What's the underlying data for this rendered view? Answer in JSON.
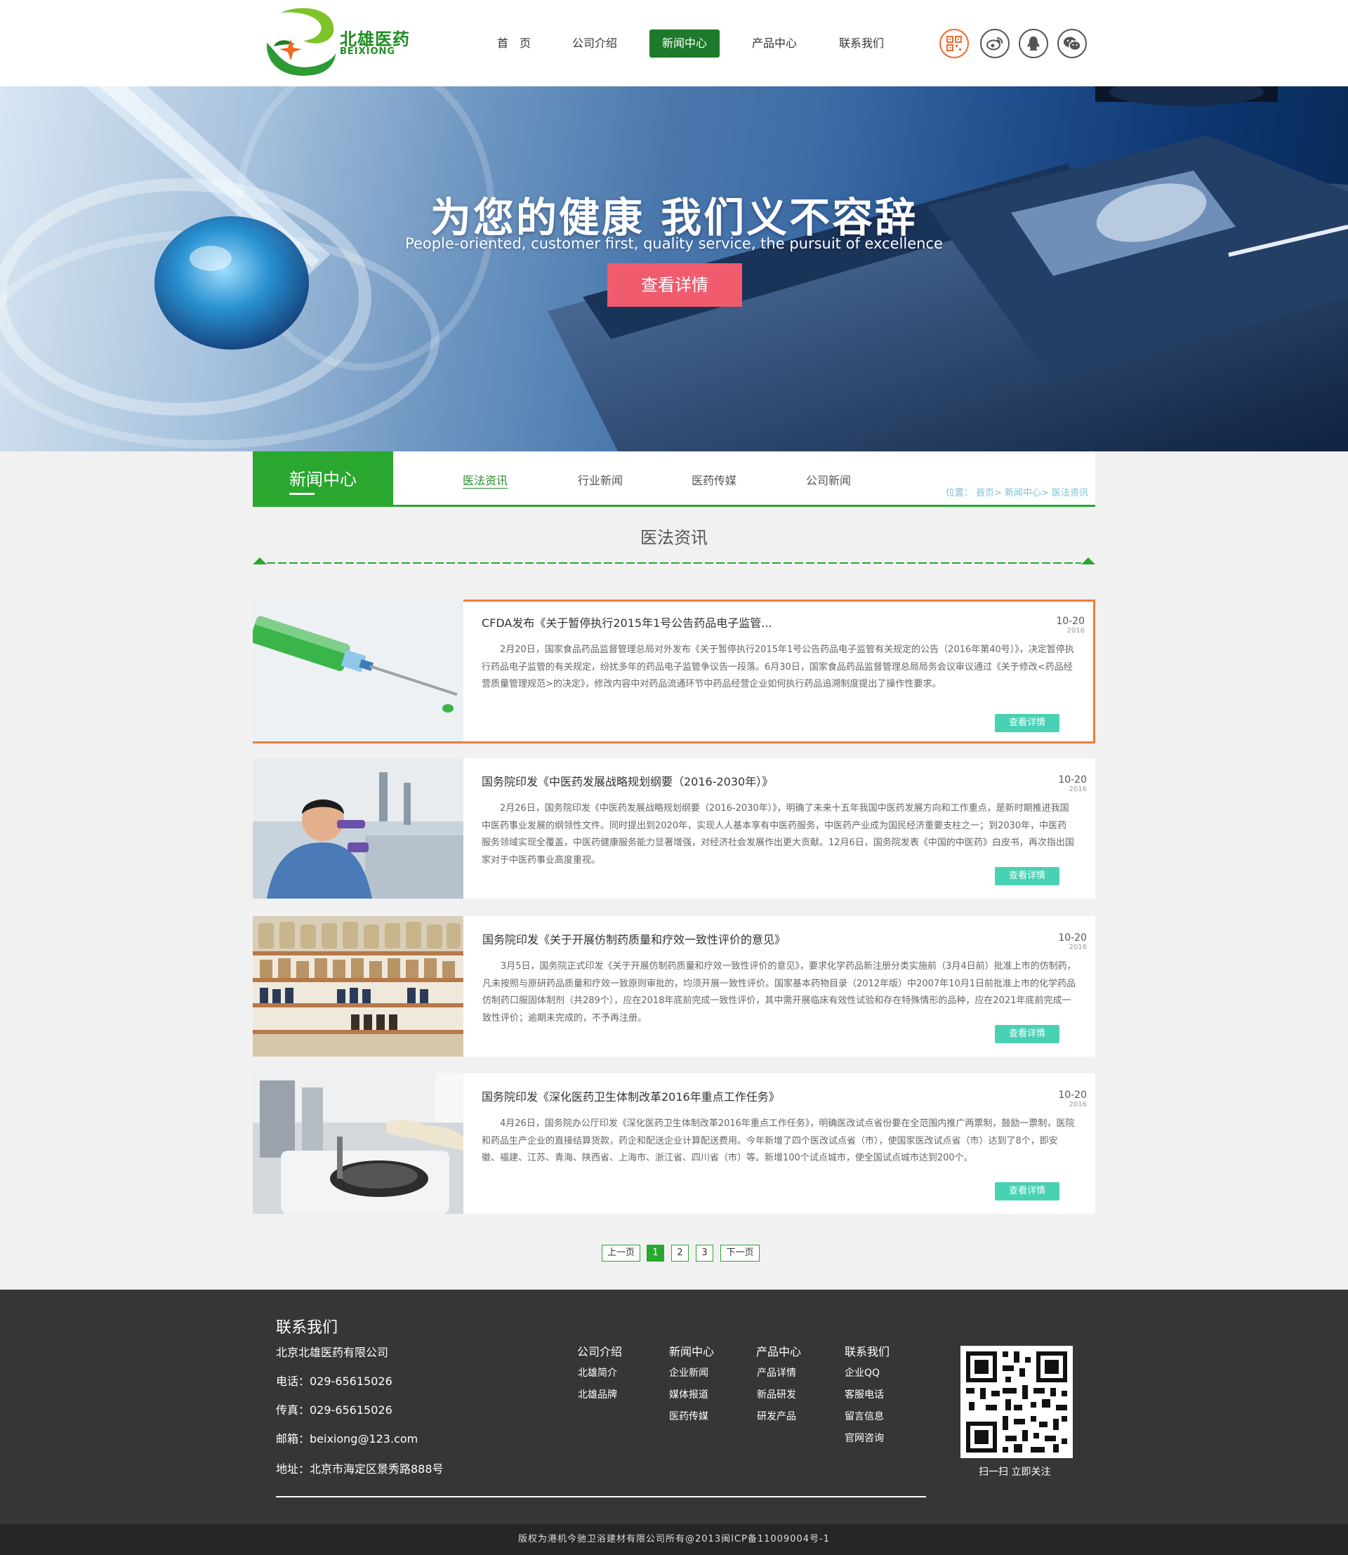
{
  "header": {
    "logo_cn": "北雄医药",
    "logo_en": "BEIXIONG",
    "nav": [
      {
        "label": "首　页"
      },
      {
        "label": "公司介绍"
      },
      {
        "label": "新闻中心"
      },
      {
        "label": "产品中心"
      },
      {
        "label": "联系我们"
      }
    ],
    "active_nav": "新闻中心",
    "social_icons": [
      "qr-code-icon",
      "weibo-icon",
      "qq-icon",
      "wechat-icon"
    ],
    "accent_color": "#1d7a2a"
  },
  "banner": {
    "title": "为您的健康 我们义不容辞",
    "subtitle": "People-oriented, customer first, quality service, the pursuit of excellence",
    "button": "查看详情",
    "button_color": "#f05b6e"
  },
  "subnav": {
    "title": "新闻中心",
    "tabs": [
      "医法资讯",
      "行业新闻",
      "医药传媒",
      "公司新闻"
    ],
    "active_tab": "医法资讯",
    "breadcrumb": "位置： 首页> 新闻中心> 医法资讯",
    "accent_color": "#2aa72f"
  },
  "section_title": "医法资讯",
  "news": [
    {
      "title": "CFDA发布《关于暂停执行2015年1号公告药品电子监管...",
      "date": "10-20",
      "year": "2016",
      "body": "2月20日，国家食品药品监督管理总局对外发布《关于暂停执行2015年1号公告药品电子监管有关规定的公告（2016年第40号）》，决定暂停执行药品电子监管的有关规定，纷扰多年的药品电子监管争议告一段落。6月30日，国家食品药品监督管理总局局务会议审议通过《关于修改<药品经营质量管理规范>的决定》，修改内容中对药品流通环节中药品经营企业如何执行药品追溯制度提出了操作性要求。",
      "button": "查看详情",
      "image": "syringe"
    },
    {
      "title": "国务院印发《中医药发展战略规划纲要（2016-2030年）》",
      "date": "10-20",
      "year": "2016",
      "body": "2月26日，国务院印发《中医药发展战略规划纲要（2016-2030年）》，明确了未来十五年我国中医药发展方向和工作重点，是新时期推进我国中医药事业发展的纲领性文件。同时提出到2020年，实现人人基本享有中医药服务，中医药产业成为国民经济重要支柱之一；到2030年，中医药服务领域实现全覆盖，中医药健康服务能力显著增强，对经济社会发展作出更大贡献。12月6日，国务院发表《中国的中医药》白皮书，再次指出国家对于中医药事业高度重视。",
      "button": "查看详情",
      "image": "lab-scientist"
    },
    {
      "title": "国务院印发《关于开展仿制药质量和疗效一致性评价的意见》",
      "date": "10-20",
      "year": "2016",
      "body": "3月5日，国务院正式印发《关于开展仿制药质量和疗效一致性评价的意见》，要求化学药品新注册分类实施前（3月4日前）批准上市的仿制药，凡未按照与原研药品质量和疗效一致原则审批的，均须开展一致性评价。国家基本药物目录（2012年版）中2007年10月1日前批准上市的化学药品仿制药口服固体制剂（共289个），应在2018年底前完成一致性评价，其中需开展临床有效性试验和存在特殊情形的品种，应在2021年底前完成一致性评价；逾期未完成的，不予再注册。",
      "button": "查看详情",
      "image": "pharmacy-shelves"
    },
    {
      "title": "国务院印发《深化医药卫生体制改革2016年重点工作任务》",
      "date": "10-20",
      "year": "2016",
      "body": "4月26日，国务院办公厅印发《深化医药卫生体制改革2016年重点工作任务》，明确医改试点省份要在全范围内推广两票制，鼓励一票制，医院和药品生产企业的直接结算货款，药企和配送企业计算配送费用。今年新增了四个医改试点省（市），使国家医改试点省（市）达到了8个，即安徽、福建、江苏、青海、陕西省、上海市、浙江省、四川省（市）等。新增100个试点城市，使全国试点城市达到200个。",
      "button": "查看详情",
      "image": "lab-machine"
    }
  ],
  "pagination": {
    "prev": "上一页",
    "pages": [
      "1",
      "2",
      "3"
    ],
    "current": "1",
    "next": "下一页"
  },
  "footer": {
    "title": "联系我们",
    "company": "北京北雄医药有限公司",
    "phone": "电话：029-65615026",
    "fax": "传真：029-65615026",
    "email": "邮箱：beixiong@123.com",
    "address": "地址：北京市海定区景秀路888号",
    "columns": [
      {
        "head": "公司介绍",
        "links": [
          "北雄简介",
          "北雄品牌"
        ]
      },
      {
        "head": "新闻中心",
        "links": [
          "企业新闻",
          "媒体报道",
          "医药传媒"
        ]
      },
      {
        "head": "产品中心",
        "links": [
          "产品详情",
          "新品研发",
          "研发产品"
        ]
      },
      {
        "head": "联系我们",
        "links": [
          "企业QQ",
          "客服电话",
          "留言信息",
          "官网咨询"
        ]
      }
    ],
    "qr_caption": "扫一扫  立即关注",
    "copyright": "版权为港机今驰卫浴建材有限公司所有@2013闽ICP备11009004号-1"
  }
}
